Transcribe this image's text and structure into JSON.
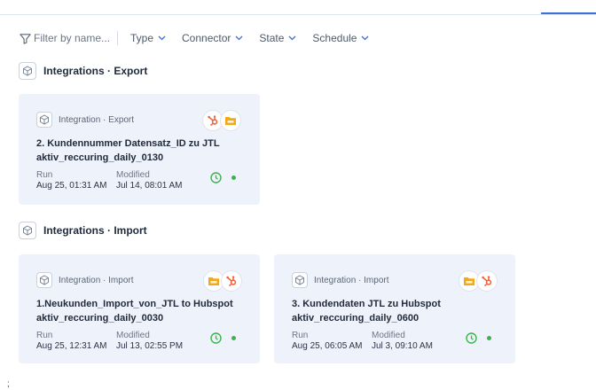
{
  "filter_bar": {
    "search_placeholder": "Filter by name...",
    "dropdowns": [
      {
        "label": "Type"
      },
      {
        "label": "Connector"
      },
      {
        "label": "State"
      },
      {
        "label": "Schedule"
      }
    ]
  },
  "sections": [
    {
      "title": "Integrations · Export",
      "cards": [
        {
          "type_label": "Integration · Export",
          "title_line1": "2. Kundennummer Datensatz_ID zu JTL",
          "title_line2": "aktiv_reccuring_daily_0130",
          "run_label": "Run",
          "run_value": "Aug 25, 01:31 AM",
          "modified_label": "Modified",
          "modified_value": "Jul 14, 08:01 AM",
          "connectors": [
            "hubspot-icon",
            "ftp-folder-icon"
          ]
        }
      ]
    },
    {
      "title": "Integrations · Import",
      "cards": [
        {
          "type_label": "Integration · Import",
          "title_line1": "1.Neukunden_Import_von_JTL to Hubspot",
          "title_line2": "aktiv_reccuring_daily_0030",
          "run_label": "Run",
          "run_value": "Aug 25, 12:31 AM",
          "modified_label": "Modified",
          "modified_value": "Jul 13, 02:55 PM",
          "connectors": [
            "ftp-folder-icon",
            "hubspot-icon"
          ]
        },
        {
          "type_label": "Integration · Import",
          "title_line1": "3. Kundendaten JTL zu Hubspot",
          "title_line2": "aktiv_reccuring_daily_0600",
          "run_label": "Run",
          "run_value": "Aug 25, 06:05 AM",
          "modified_label": "Modified",
          "modified_value": "Jul 3, 09:10 AM",
          "connectors": [
            "ftp-folder-icon",
            "hubspot-icon"
          ]
        }
      ]
    }
  ],
  "stray_text": ";",
  "colors": {
    "accent": "#3f6fd8",
    "card_bg": "#eef2fb",
    "hubspot": "#f0643c",
    "ftp_folder": "#f2a91c",
    "status_green": "#3fb24d"
  }
}
